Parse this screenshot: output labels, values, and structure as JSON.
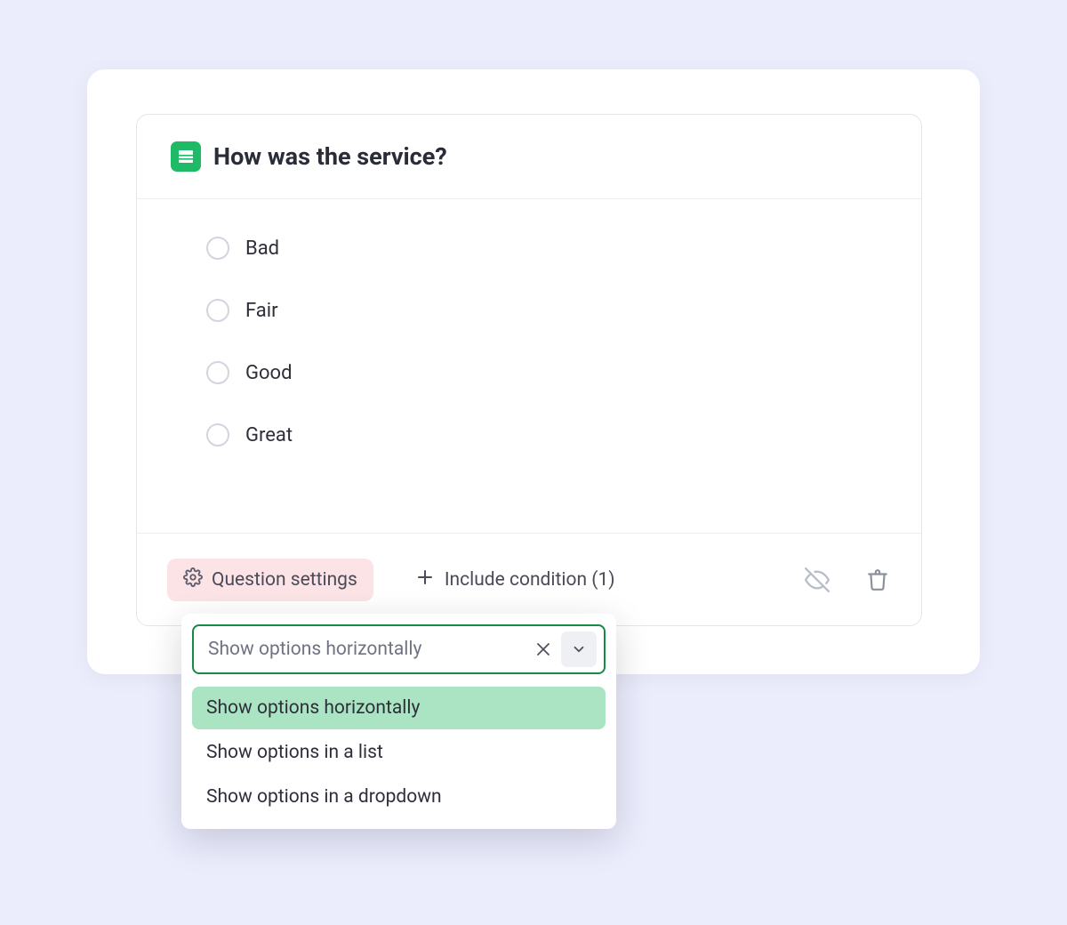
{
  "question": {
    "title": "How was the service?",
    "options": [
      "Bad",
      "Fair",
      "Good",
      "Great"
    ]
  },
  "footer": {
    "settings_label": "Question settings",
    "condition_label": "Include condition (1)"
  },
  "dropdown": {
    "current_value": "Show options horizontally",
    "options": [
      "Show options horizontally",
      "Show options in a list",
      "Show options in a dropdown"
    ],
    "selected_index": 0
  }
}
